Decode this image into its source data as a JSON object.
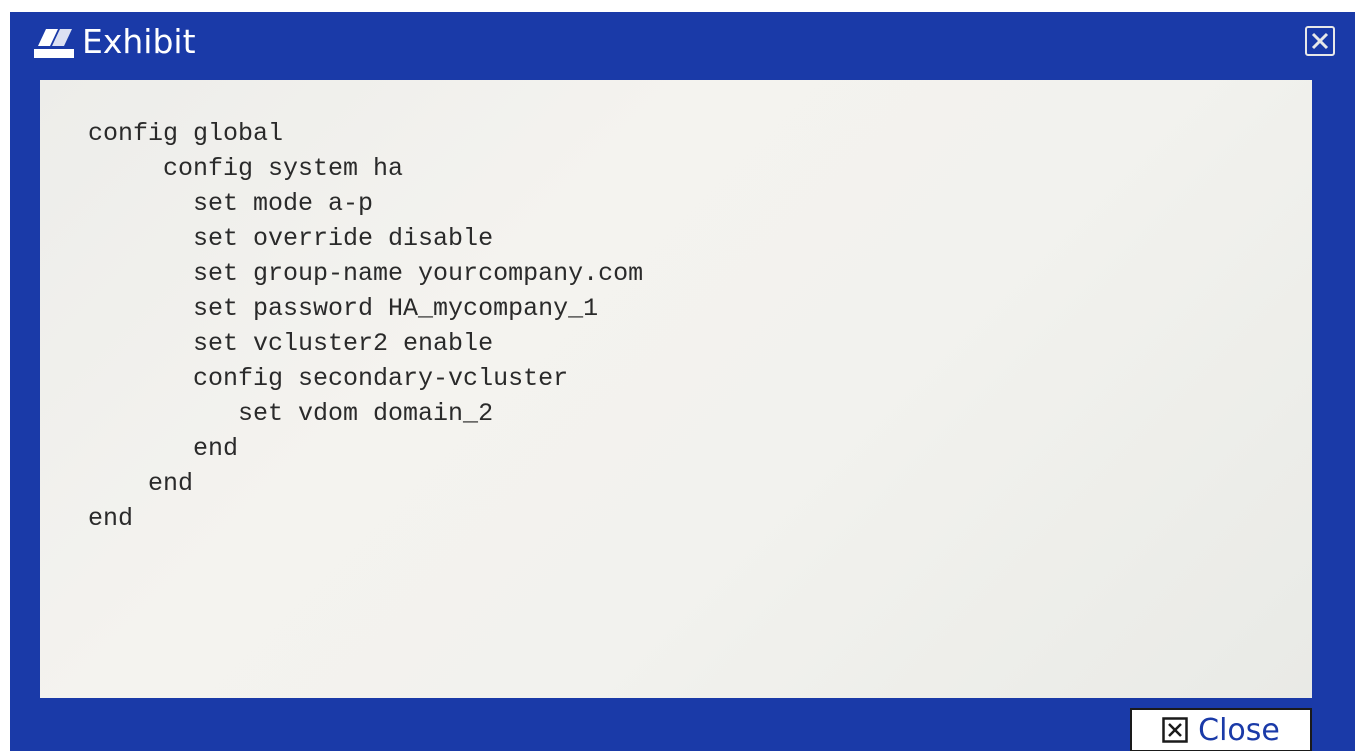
{
  "window": {
    "title": "Exhibit",
    "close_button_label": "Close"
  },
  "code_lines": [
    "config global",
    "     config system ha",
    "       set mode a-p",
    "       set override disable",
    "       set group-name yourcompany.com",
    "       set password HA_mycompany_1",
    "       set vcluster2 enable",
    "       config secondary-vcluster",
    "          set vdom domain_2",
    "       end",
    "    end",
    "end"
  ],
  "icons": {
    "app": "exhibit-icon",
    "title_close": "close-icon",
    "button_close": "close-icon"
  },
  "colors": {
    "titlebar": "#1a3aa8",
    "content_bg": "#f1f1ed",
    "code_text": "#2a2a2a",
    "button_text": "#1a3aa8"
  }
}
